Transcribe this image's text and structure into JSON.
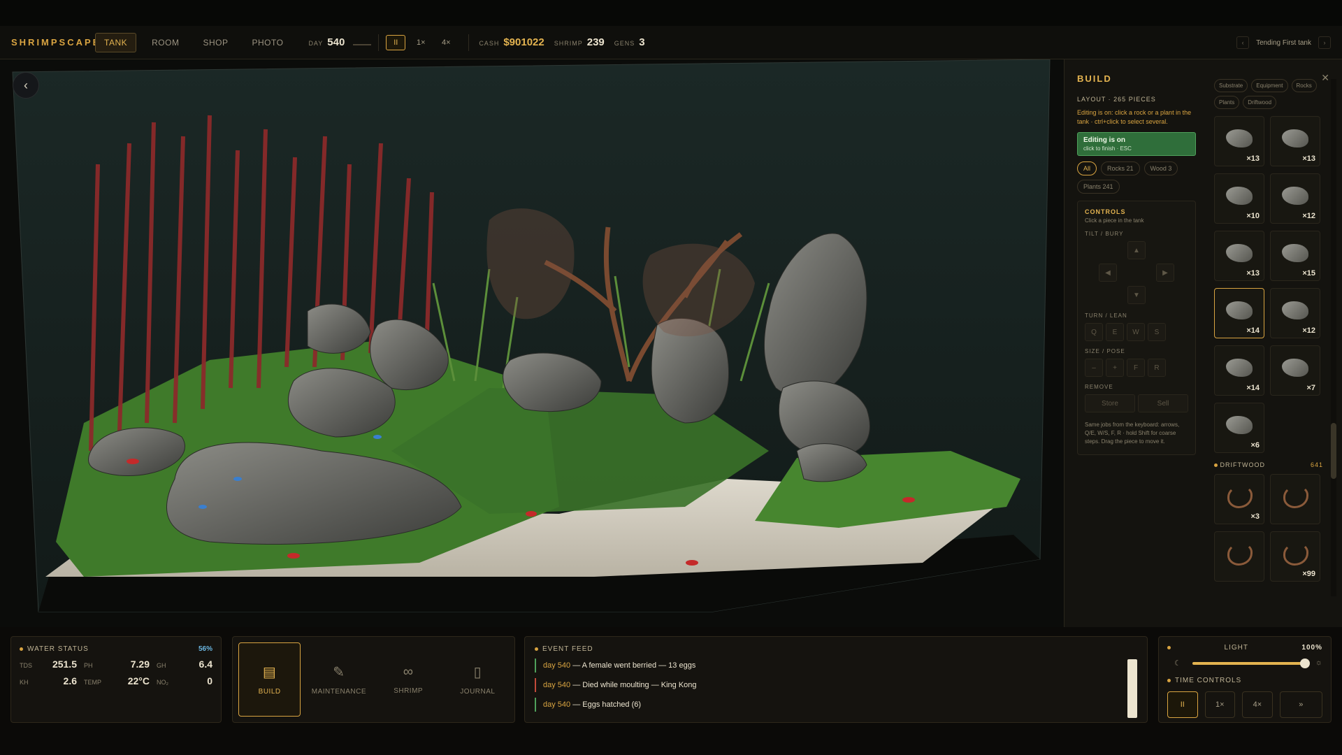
{
  "app": {
    "logo": "SHRIMPSCAPE"
  },
  "nav": {
    "tabs": [
      "TANK",
      "ROOM",
      "SHOP",
      "PHOTO"
    ],
    "active": "TANK"
  },
  "stats": {
    "day_label": "DAY",
    "day": "540",
    "cash_label": "CASH",
    "cash": "$901022",
    "shrimp_label": "SHRIMP",
    "shrimp": "239",
    "gens_label": "GENS",
    "gens": "3"
  },
  "speed": {
    "pause": "II",
    "one": "1×",
    "four": "4×"
  },
  "goal": {
    "prev": "‹",
    "text": "Tending First tank",
    "next": "›"
  },
  "build": {
    "title": "BUILD",
    "close": "✕",
    "layout": "LAYOUT · 265 PIECES",
    "hint": "Editing is on: click a rock or a plant in the tank · ctrl+click to select several.",
    "editing_title": "Editing is on",
    "editing_sub": "click to finish · ESC",
    "filters": [
      "All",
      "Rocks 21",
      "Wood 3",
      "Plants 241"
    ],
    "controls_title": "CONTROLS",
    "controls_sub": "Click a piece in the tank",
    "tilt_label": "TILT / BURY",
    "turn_label": "TURN / LEAN",
    "size_label": "SIZE / POSE",
    "remove_label": "REMOVE",
    "turn_keys": [
      "Q",
      "E",
      "W",
      "S"
    ],
    "size_keys": [
      "–",
      "+",
      "F",
      "R"
    ],
    "store": "Store",
    "sell": "Sell",
    "kb_hint": "Same jobs from the keyboard: arrows, Q/E, W/S, F, R · hold Shift for coarse steps. Drag the piece to move it.",
    "categories": [
      "Substrate",
      "Equipment",
      "Rocks",
      "Plants",
      "Driftwood"
    ],
    "rock_counts": [
      "×13",
      "×13",
      "×10",
      "×12",
      "×13",
      "×15",
      "×14",
      "×12",
      "×14",
      "×7",
      "×6"
    ],
    "driftwood_label": "DRIFTWOOD",
    "driftwood_count": "641",
    "wood_counts": [
      "×3",
      "",
      "",
      "×99"
    ]
  },
  "water": {
    "title": "WATER STATUS",
    "pct": "56%",
    "rows": [
      [
        "TDS",
        "251.5",
        "PH",
        "7.29",
        "GH",
        "6.4"
      ],
      [
        "KH",
        "2.6",
        "TEMP",
        "22°C",
        "NO₂",
        "0"
      ]
    ]
  },
  "bottom_nav": {
    "build": "BUILD",
    "maintenance": "MAINTENANCE",
    "shrimp": "SHRIMP",
    "journal": "JOURNAL"
  },
  "feed": {
    "title": "EVENT FEED",
    "events": [
      {
        "day": "day 540",
        "text": "— A female went berried — 13 eggs"
      },
      {
        "day": "day 540",
        "text": "— Died while moulting — King Kong"
      },
      {
        "day": "day 540",
        "text": "— Eggs hatched (6)"
      }
    ]
  },
  "light": {
    "title": "LIGHT",
    "value": "100%",
    "level": 1.0
  },
  "time": {
    "title": "TIME CONTROLS",
    "pause": "II",
    "one": "1×",
    "four": "4×",
    "ff": "»"
  },
  "colors": {
    "accent": "#d9a441",
    "editing": "#2f6e3a"
  }
}
